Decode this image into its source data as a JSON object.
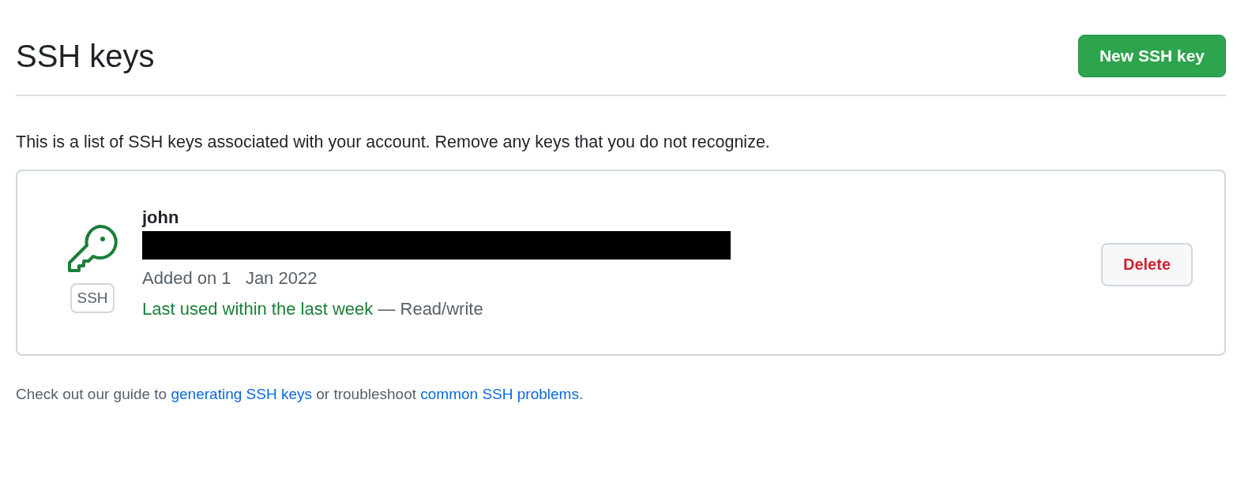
{
  "header": {
    "title": "SSH keys",
    "new_button": "New SSH key"
  },
  "description": "This is a list of SSH keys associated with your account. Remove any keys that you do not recognize.",
  "keys": [
    {
      "name": "john",
      "badge": "SSH",
      "fingerprint_redacted": true,
      "added": "Added on 1   Jan 2022",
      "last_used": "Last used within the last week",
      "access": " — Read/write",
      "delete_button": "Delete"
    }
  ],
  "footer": [
    {
      "kind": "text",
      "text": "Check out our guide to "
    },
    {
      "kind": "link",
      "text": "generating SSH keys"
    },
    {
      "kind": "text",
      "text": " or troubleshoot "
    },
    {
      "kind": "link",
      "text": "common SSH problems"
    },
    {
      "kind": "text",
      "text": "."
    }
  ]
}
